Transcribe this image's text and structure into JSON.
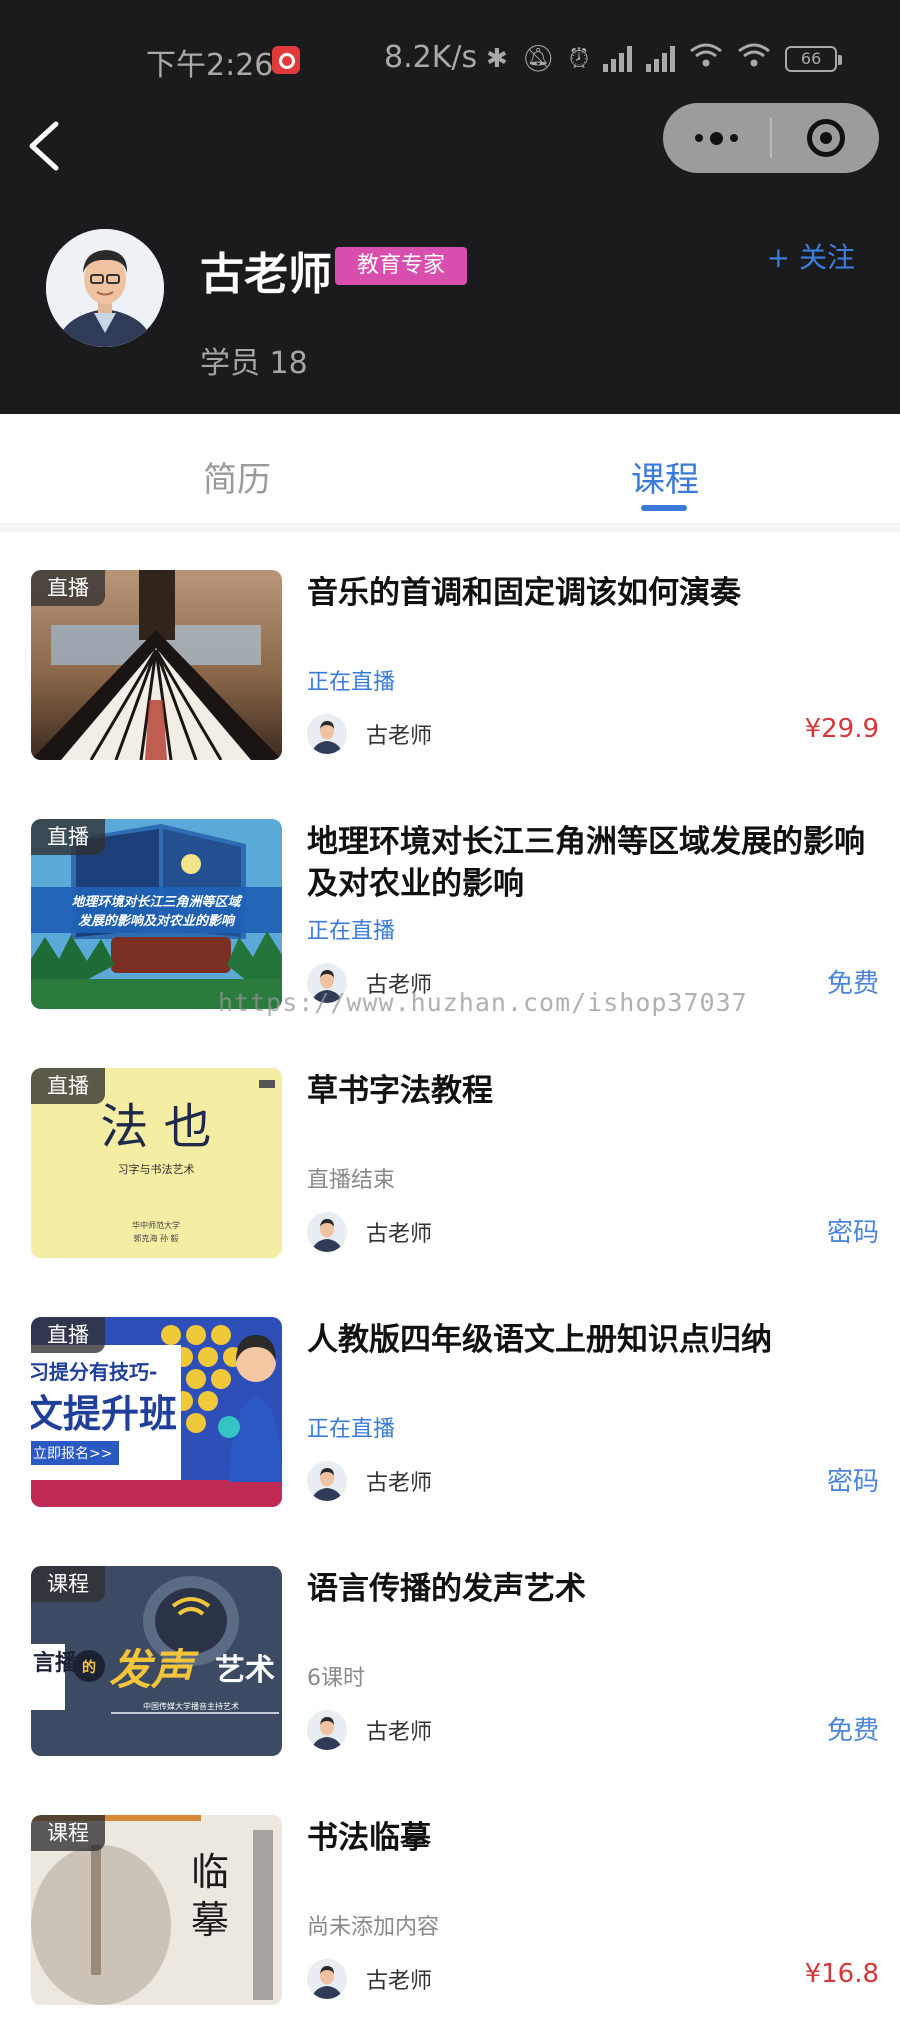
{
  "status_bar": {
    "time": "下午2:26",
    "net_speed": "8.2K/s",
    "battery": "66",
    "icons": [
      "netease-music-icon",
      "bluetooth-icon",
      "mute-icon",
      "alarm-icon",
      "hd-signal-icon",
      "hd-signal-icon",
      "wifi-icon",
      "wifi-icon",
      "battery-icon"
    ]
  },
  "profile": {
    "name": "古老师",
    "badge": "教育专家",
    "follow": "+ 关注",
    "students": "学员 18"
  },
  "tabs": [
    {
      "label": "简历",
      "active": false
    },
    {
      "label": "课程",
      "active": true
    }
  ],
  "courses": [
    {
      "tag": "直播",
      "title": "音乐的首调和固定调该如何演奏",
      "status": "正在直播",
      "teacher": "古老师",
      "price": "¥29.9"
    },
    {
      "tag": "直播",
      "title": "地理环境对长江三角洲等区域发展的影响及对农业的影响",
      "status": "正在直播",
      "teacher": "古老师",
      "price": "免费"
    },
    {
      "tag": "直播",
      "title": "草书字法教程",
      "status": "直播结束",
      "teacher": "古老师",
      "price": "密码"
    },
    {
      "tag": "直播",
      "title": "人教版四年级语文上册知识点归纳",
      "status": "正在直播",
      "teacher": "古老师",
      "price": "密码"
    },
    {
      "tag": "课程",
      "title": "语言传播的发声艺术",
      "status": "6课时",
      "teacher": "古老师",
      "price": "免费"
    },
    {
      "tag": "课程",
      "title": "书法临摹",
      "status": "尚未添加内容",
      "teacher": "古老师",
      "price": "¥16.8"
    }
  ],
  "thumbnail_text": {
    "geo_line1": "地理环境对长江三角洲等区域",
    "geo_line2": "发展的影响及对农业的影响",
    "cal_title": "法 也",
    "cal_subtitle": "习字与书法艺术",
    "cal_publisher": "华中师范大学",
    "cal_authors": "郭克海  孙 毅",
    "chn_line1": "习提分有技巧-",
    "chn_line2": "文提升班",
    "chn_btn": "立即报名>>",
    "voice_main": "发声",
    "voice_side": "艺术",
    "voice_mid": "的",
    "voice_left": "言播",
    "voice_caption": "中国传媒大学播音主持艺术",
    "cal2_a": "临",
    "cal2_b": "摹"
  },
  "watermark": "https://www.huzhan.com/ishop37037",
  "colors": {
    "header_bg": "#1b1b1d",
    "accent_blue": "#3b7bd8",
    "badge_pink": "#d84fb0",
    "price_red": "#d4383a"
  }
}
